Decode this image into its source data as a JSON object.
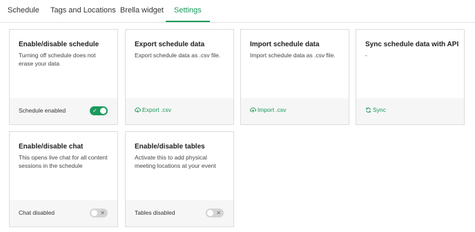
{
  "tabs": [
    {
      "label": "Schedule",
      "active": false
    },
    {
      "label": "Tags and Locations",
      "active": false
    },
    {
      "label": "Brella widget",
      "active": false
    },
    {
      "label": "Settings",
      "active": true
    }
  ],
  "cards": {
    "schedule": {
      "title": "Enable/disable schedule",
      "description": "Turning off schedule does not erase your data",
      "status": "Schedule enabled",
      "toggle": "on"
    },
    "export": {
      "title": "Export schedule data",
      "description": "Export schedule data as .csv file.",
      "action": "Export .csv",
      "icon": "cloud-download-icon"
    },
    "import": {
      "title": "Import schedule data",
      "description": "Import schedule data as .csv file.",
      "action": "Import .csv",
      "icon": "cloud-upload-icon"
    },
    "sync": {
      "title": "Sync schedule data with API",
      "description": "-",
      "action": "Sync",
      "icon": "sync-icon"
    },
    "chat": {
      "title": "Enable/disable chat",
      "description": "This opens live chat for all content sessions in the schedule",
      "status": "Chat disabled",
      "toggle": "off"
    },
    "tables": {
      "title": "Enable/disable tables",
      "description": "Activate this to add physical meeting locations at your event",
      "status": "Tables disabled",
      "toggle": "off"
    }
  },
  "colors": {
    "accent": "#1a9a5b",
    "toggle_off": "#d4d4d4",
    "footer_bg": "#f6f6f6",
    "border": "#dcdcdc"
  }
}
